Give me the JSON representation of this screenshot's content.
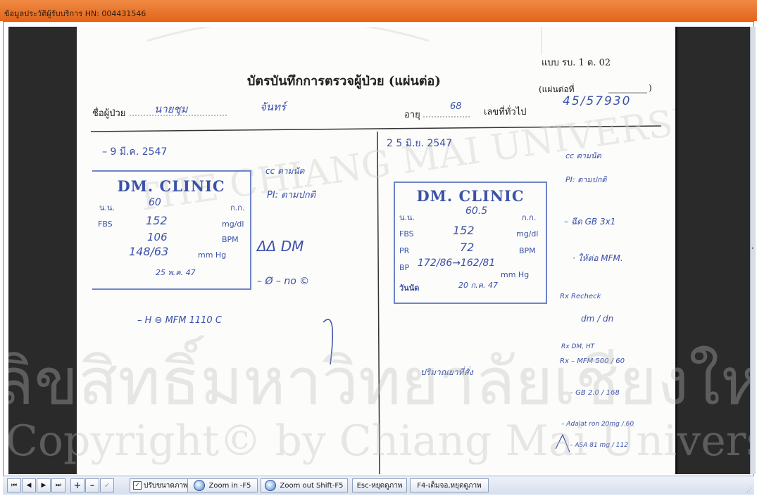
{
  "window": {
    "title": "ข้อมูลประวัติผู้รับบริการ  HN: 004431546"
  },
  "scan": {
    "form_code": "แบบ  รบ.  1  ต.  02",
    "heading": "บัตรบันทึกการตรวจผู้ป่วย (แผ่นต่อ)",
    "sheet_label": "(แผ่นต่อที่",
    "sheet_close": ")",
    "patient_label": "ชื่อผู้ป่วย",
    "patient_name_hw": "นายชุม",
    "patient_surname_hw": "จันทร์",
    "age_label": "อายุ",
    "age_hw": "68",
    "hn_label": "เลขที่ทั่วไป",
    "hn_hw": "45/57930",
    "left_date": "– 9  มี.ค. 2547",
    "right_date": "2 5  มิ.ย. 2547",
    "left_stamp": {
      "name": "DM. CLINIC",
      "nn_label": "น.น.",
      "nn_unit": "ก.ก.",
      "nn_val": "60",
      "fbs_label": "FBS",
      "fbs_unit": "mg/dl",
      "fbs_val": "152",
      "pr_val": "106",
      "pr_unit": "BPM",
      "bp_val": "148/63",
      "bp_unit": "mm Hg",
      "appt_val": "25 พ.ค. 47"
    },
    "right_stamp": {
      "name": "DM. CLINIC",
      "nn_label": "น.น.",
      "nn_unit": "ก.ก.",
      "nn_val": "60.5",
      "fbs_label": "FBS",
      "fbs_unit": "mg/dl",
      "fbs_val": "152",
      "pr_label": "PR",
      "pr_unit": "BPM",
      "pr_val": "72",
      "bp_label": "BP",
      "bp_unit": "mm Hg",
      "bp_val": "172/86→162/81",
      "appt_label": "วันนัด",
      "appt_val": "20 ก.ค. 47"
    },
    "notes_left": [
      "cc ตามนัด",
      "PI: ตามปกติ",
      "ΔΔ DM",
      "– Ø – no ©",
      "– H ⊖ MFM 1110 C"
    ],
    "notes_right": [
      "cc ตามนัด",
      "PI: ตามปกติ",
      "– ฉีด GB 3x1",
      "· ให้ต่อ MFM.",
      "Rx Recheck",
      "dm / dn",
      "Rx DM, HT",
      "Rx – MFM 500 / 60",
      "– GB 2.0 / 168",
      "– Adalat ron 20mg / 60",
      "– ASA 81 mg / 112"
    ],
    "notes_bottom": "ปริมาณยาที่สั่ง",
    "watermark_top": "THE CHIANG MAI UNIVERSITY",
    "watermark_thai": "ลิขสิทธิ์มหาวิทยาลัยเชียงใหม่",
    "watermark_copy": "Copyright© by Chiang Mai University"
  },
  "toolbar": {
    "first": "⏮",
    "prev": "◀",
    "next": "▶",
    "last": "⏭",
    "add": "+",
    "remove": "–",
    "confirm": "✓",
    "fit_label": "ปรับขนาดภาพ",
    "zoom_in": "Zoom in -F5",
    "zoom_out": "Zoom out Shift-F5",
    "esc": "Esc-หยุดดูภาพ",
    "f4": "F4-เต็มจอ,หยุดดูภาพ"
  }
}
